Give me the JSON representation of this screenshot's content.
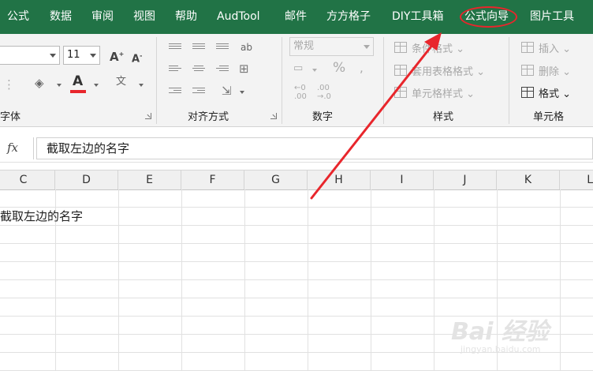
{
  "tabs": [
    {
      "label": "公式"
    },
    {
      "label": "数据"
    },
    {
      "label": "审阅"
    },
    {
      "label": "视图"
    },
    {
      "label": "帮助"
    },
    {
      "label": "AudTool"
    },
    {
      "label": "邮件"
    },
    {
      "label": "方方格子"
    },
    {
      "label": "DIY工具箱"
    },
    {
      "label": "公式向导"
    },
    {
      "label": "图片工具"
    }
  ],
  "ribbon": {
    "font": {
      "label": "字体",
      "size": "11"
    },
    "alignment": {
      "label": "对齐方式"
    },
    "number": {
      "label": "数字",
      "format": "常规"
    },
    "styles": {
      "label": "样式",
      "conditional": "条件格式",
      "table": "套用表格格式",
      "cell": "单元格样式"
    },
    "cells": {
      "label": "单元格",
      "insert": "插入",
      "delete": "删除",
      "format": "格式"
    }
  },
  "formula_bar": {
    "fx": "fx",
    "content": "截取左边的名字"
  },
  "columns": [
    "C",
    "D",
    "E",
    "F",
    "G",
    "H",
    "I",
    "J",
    "K",
    "L"
  ],
  "cell_text": "截取左边的名字",
  "watermark": {
    "main": "Bai 经验",
    "url": "jingyan.baidu.com"
  },
  "colors": {
    "ribbon_tab_bg": "#217346",
    "annotation": "#e8262c",
    "font_color_bar": "#e8262c"
  }
}
